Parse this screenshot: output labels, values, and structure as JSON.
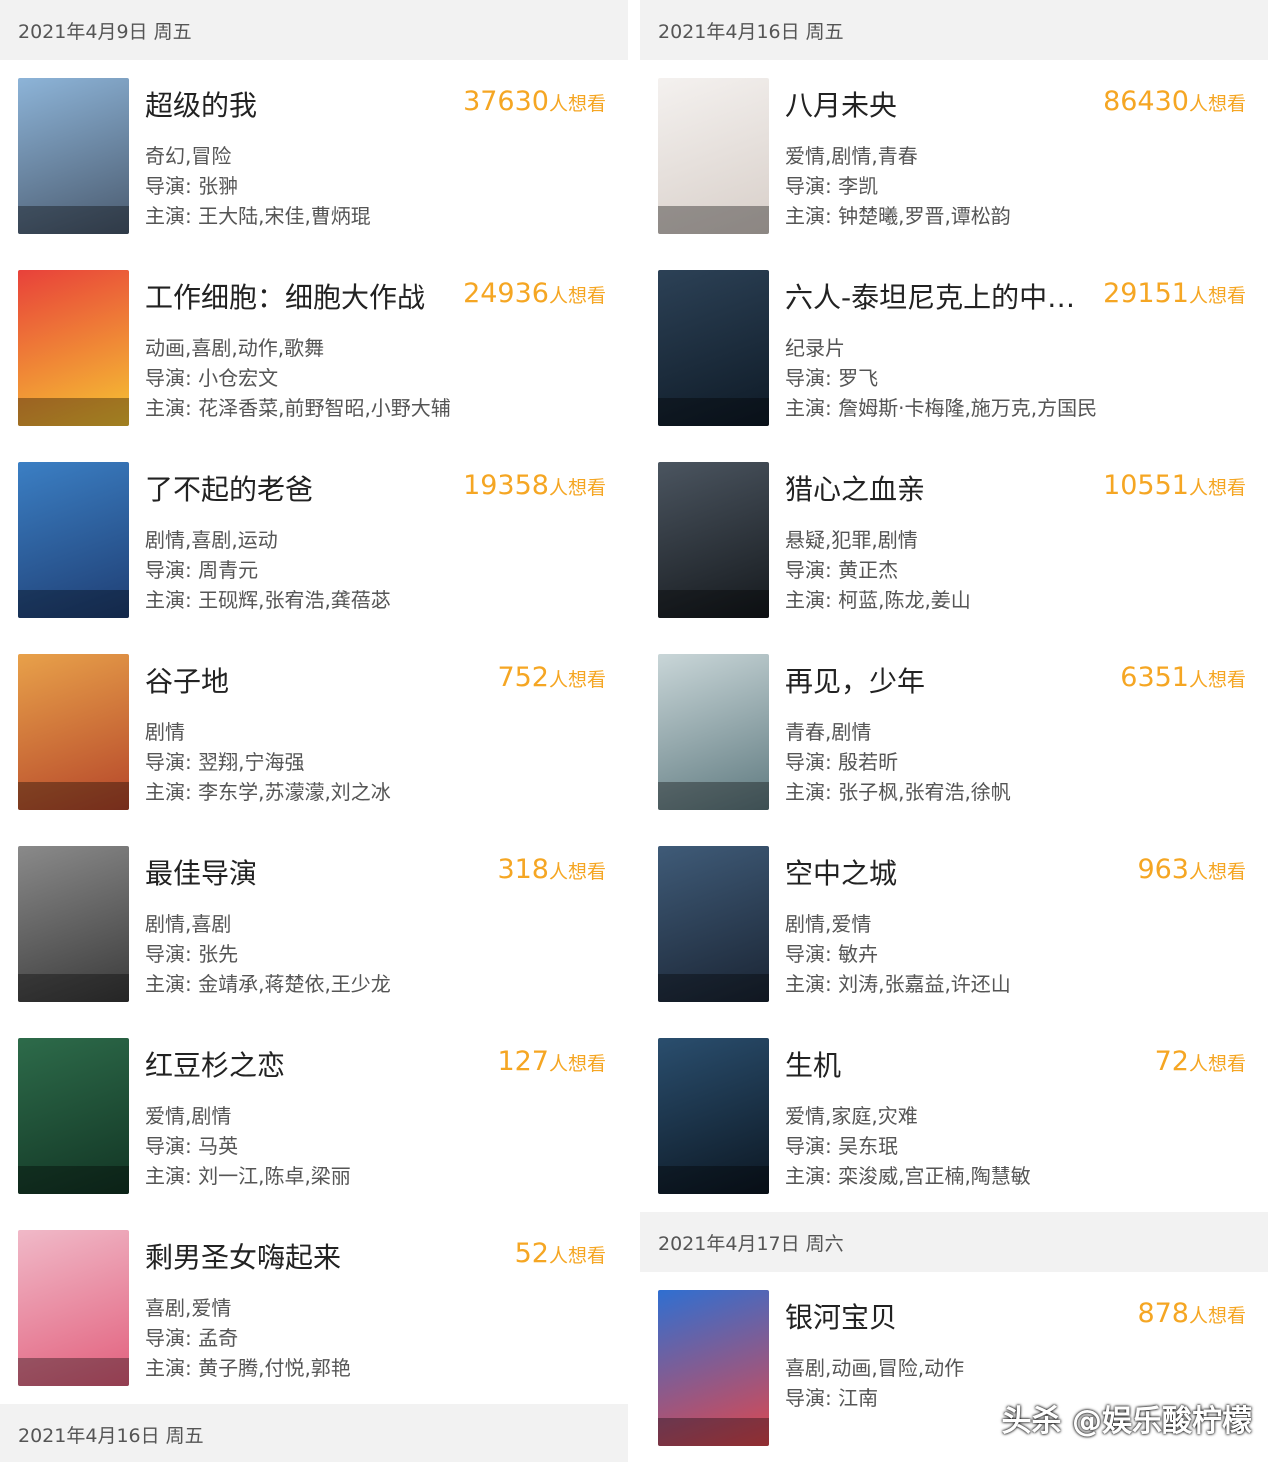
{
  "left": {
    "header": "2021年4月9日 周五",
    "items": [
      {
        "title": "超级的我",
        "count": "37630",
        "suffix": "人想看",
        "genre": "奇幻,冒险",
        "director": "导演: 张翀",
        "cast": "主演: 王大陆,宋佳,曹炳琨",
        "colors": [
          "#8db4d8",
          "#4a5a6e"
        ]
      },
      {
        "title": "工作细胞：细胞大作战",
        "count": "24936",
        "suffix": "人想看",
        "genre": "动画,喜剧,动作,歌舞",
        "director": "导演: 小仓宏文",
        "cast": "主演: 花泽香菜,前野智昭,小野大辅",
        "colors": [
          "#e8413a",
          "#f6c533"
        ]
      },
      {
        "title": "了不起的老爸",
        "count": "19358",
        "suffix": "人想看",
        "genre": "剧情,喜剧,运动",
        "director": "导演: 周青元",
        "cast": "主演: 王砚辉,张宥浩,龚蓓苾",
        "colors": [
          "#3b7fc4",
          "#1f3e73"
        ]
      },
      {
        "title": "谷子地",
        "count": "752",
        "suffix": "人想看",
        "genre": "剧情",
        "director": "导演: 翌翔,宁海强",
        "cast": "主演: 李东学,苏濛濛,刘之冰",
        "colors": [
          "#e8a14a",
          "#b5462a"
        ]
      },
      {
        "title": "最佳导演",
        "count": "318",
        "suffix": "人想看",
        "genre": "剧情,喜剧",
        "director": "导演: 张先",
        "cast": "主演: 金靖承,蒋楚依,王少龙",
        "colors": [
          "#8a8a8a",
          "#3a3a3a"
        ]
      },
      {
        "title": "红豆杉之恋",
        "count": "127",
        "suffix": "人想看",
        "genre": "爱情,剧情",
        "director": "导演: 马英",
        "cast": "主演: 刘一江,陈卓,梁丽",
        "colors": [
          "#2d6b4a",
          "#123524"
        ]
      },
      {
        "title": "剩男圣女嗨起来",
        "count": "52",
        "suffix": "人想看",
        "genre": "喜剧,爱情",
        "director": "导演: 孟奇",
        "cast": "主演: 黄子腾,付悦,郭艳",
        "colors": [
          "#f0b9c8",
          "#e25f7c"
        ]
      }
    ],
    "footer_header": "2021年4月16日 周五"
  },
  "right": {
    "header": "2021年4月16日 周五",
    "items": [
      {
        "title": "八月未央",
        "count": "86430",
        "suffix": "人想看",
        "genre": "爱情,剧情,青春",
        "director": "导演: 李凯",
        "cast": "主演: 钟楚曦,罗晋,谭松韵",
        "colors": [
          "#f4f1ef",
          "#d8cfc9"
        ]
      },
      {
        "title": "六人-泰坦尼克上的中…",
        "count": "29151",
        "suffix": "人想看",
        "genre": "纪录片",
        "director": "导演: 罗飞",
        "cast": "主演: 詹姆斯·卡梅隆,施万克,方国民",
        "colors": [
          "#2c4156",
          "#0e1a26"
        ]
      },
      {
        "title": "猎心之血亲",
        "count": "10551",
        "suffix": "人想看",
        "genre": "悬疑,犯罪,剧情",
        "director": "导演: 黄正杰",
        "cast": "主演: 柯蓝,陈龙,姜山",
        "colors": [
          "#4b5560",
          "#15191d"
        ]
      },
      {
        "title": "再见，少年",
        "count": "6351",
        "suffix": "人想看",
        "genre": "青春,剧情",
        "director": "导演: 殷若昕",
        "cast": "主演: 张子枫,张宥浩,徐帆",
        "colors": [
          "#c9d6d8",
          "#5f7a80"
        ]
      },
      {
        "title": "空中之城",
        "count": "963",
        "suffix": "人想看",
        "genre": "剧情,爱情",
        "director": "导演: 敏卉",
        "cast": "主演: 刘涛,张嘉益,许还山",
        "colors": [
          "#3f5b78",
          "#1a2433"
        ]
      },
      {
        "title": "生机",
        "count": "72",
        "suffix": "人想看",
        "genre": "爱情,家庭,灾难",
        "director": "导演: 吴东珉",
        "cast": "主演: 栾浚威,宫正楠,陶慧敏",
        "colors": [
          "#2a4e6e",
          "#0c1722"
        ]
      }
    ],
    "second_header": "2021年4月17日 周六",
    "second_items": [
      {
        "title": "银河宝贝",
        "count": "878",
        "suffix": "人想看",
        "genre": "喜剧,动画,冒险,动作",
        "director": "导演: 江南",
        "cast": "",
        "colors": [
          "#2f6fd1",
          "#e0474c"
        ]
      }
    ]
  },
  "watermark": "头杀 @娱乐酸柠檬",
  "poster_labels": {
    "超级的我": "超级的我",
    "红豆杉之恋": "红豆杉之恋",
    "生机": "生机",
    "空中之城": "空中之城",
    "银河宝贝": "银河宝贝"
  }
}
